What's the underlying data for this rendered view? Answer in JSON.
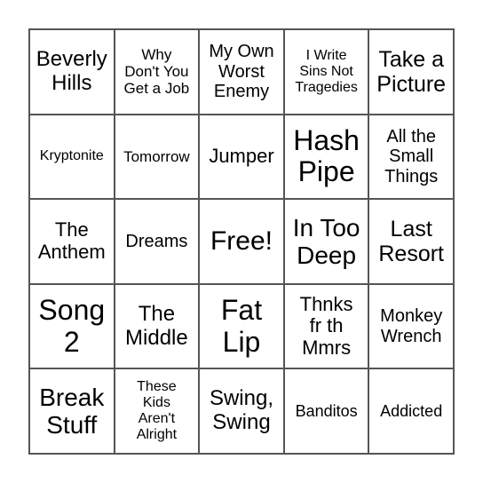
{
  "card": {
    "cells": [
      {
        "text": "Beverly\nHills",
        "size": "s24"
      },
      {
        "text": "Why\nDon't You\nGet a Job",
        "size": "s17"
      },
      {
        "text": "My Own\nWorst\nEnemy",
        "size": "s20"
      },
      {
        "text": "I Write\nSins Not\nTragedies",
        "size": "s16"
      },
      {
        "text": "Take a\nPicture",
        "size": "s25"
      },
      {
        "text": "Kryptonite",
        "size": "s16"
      },
      {
        "text": "Tomorrow",
        "size": "s17"
      },
      {
        "text": "Jumper",
        "size": "s22"
      },
      {
        "text": "Hash\nPipe",
        "size": "s32"
      },
      {
        "text": "All the\nSmall\nThings",
        "size": "s20"
      },
      {
        "text": "The\nAnthem",
        "size": "s22"
      },
      {
        "text": "Dreams",
        "size": "s20"
      },
      {
        "text": "Free!",
        "size": "s30"
      },
      {
        "text": "In Too\nDeep",
        "size": "s28"
      },
      {
        "text": "Last\nResort",
        "size": "s25"
      },
      {
        "text": "Song\n2",
        "size": "s32"
      },
      {
        "text": "The\nMiddle",
        "size": "s24"
      },
      {
        "text": "Fat\nLip",
        "size": "s32"
      },
      {
        "text": "Thnks\nfr th\nMmrs",
        "size": "s22"
      },
      {
        "text": "Monkey\nWrench",
        "size": "s20"
      },
      {
        "text": "Break\nStuff",
        "size": "s28"
      },
      {
        "text": "These\nKids\nAren't\nAlright",
        "size": "s16"
      },
      {
        "text": "Swing,\nSwing",
        "size": "s24"
      },
      {
        "text": "Banditos",
        "size": "s18"
      },
      {
        "text": "Addicted",
        "size": "s18"
      }
    ]
  }
}
